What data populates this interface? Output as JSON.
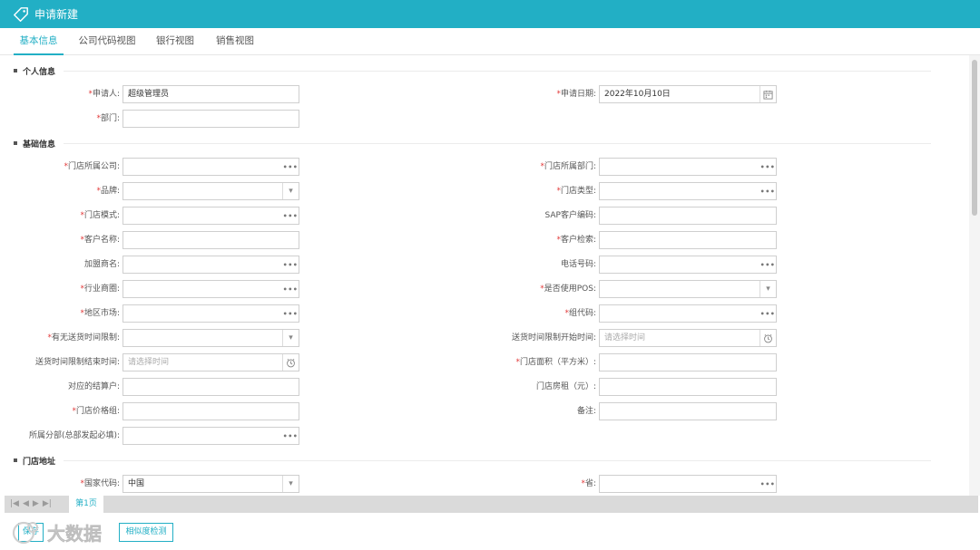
{
  "window": {
    "title": "申请新建"
  },
  "tabs": [
    {
      "label": "基本信息"
    },
    {
      "label": "公司代码视图"
    },
    {
      "label": "银行视图"
    },
    {
      "label": "销售视图"
    }
  ],
  "sections": {
    "personal": "个人信息",
    "basic": "基础信息",
    "address": "门店地址"
  },
  "fields": {
    "applicant": {
      "label": "申请人:",
      "value": "超级管理员"
    },
    "apply_date": {
      "label": "申请日期:",
      "value": "2022年10月10日"
    },
    "department": {
      "label": "部门:",
      "value": ""
    },
    "store_company": {
      "label": "门店所属公司:",
      "value": ""
    },
    "store_dept": {
      "label": "门店所属部门:",
      "value": ""
    },
    "brand": {
      "label": "品牌:",
      "value": ""
    },
    "store_type": {
      "label": "门店类型:",
      "value": ""
    },
    "store_mode": {
      "label": "门店模式:",
      "value": ""
    },
    "sap_code": {
      "label": "SAP客户编码:",
      "value": ""
    },
    "customer_name": {
      "label": "客户名称:",
      "value": ""
    },
    "customer_search": {
      "label": "客户检索:",
      "value": ""
    },
    "franchisee": {
      "label": "加盟商名:",
      "value": ""
    },
    "phone": {
      "label": "电话号码:",
      "value": ""
    },
    "business_circle": {
      "label": "行业商圈:",
      "value": ""
    },
    "use_pos": {
      "label": "是否使用POS:",
      "value": ""
    },
    "region_market": {
      "label": "地区市场:",
      "value": ""
    },
    "group_code": {
      "label": "组代码:",
      "value": ""
    },
    "delivery_limit": {
      "label": "有无送货时间限制:",
      "value": ""
    },
    "delivery_start": {
      "label": "送货时间限制开始时间:",
      "placeholder": "请选择时间"
    },
    "delivery_end": {
      "label": "送货时间限制结束时间:",
      "placeholder": "请选择时间"
    },
    "store_area": {
      "label": "门店面积（平方米）:",
      "value": ""
    },
    "settlement": {
      "label": "对应的结算户:",
      "value": ""
    },
    "store_rent": {
      "label": "门店房租（元）:",
      "value": ""
    },
    "price_group": {
      "label": "门店价格组:",
      "value": ""
    },
    "remark": {
      "label": "备注:",
      "value": ""
    },
    "branch": {
      "label": "所属分部(总部发起必填):",
      "value": ""
    },
    "country_code": {
      "label": "国家代码:",
      "value": "中国"
    },
    "province": {
      "label": "省:",
      "value": ""
    }
  },
  "pager": {
    "page_label": "第1页"
  },
  "footer": {
    "btn1": "保存",
    "btn2": "相似度检测"
  },
  "watermark": {
    "text": "大数据"
  },
  "colors": {
    "accent": "#22afc5",
    "required": "#e23b3b"
  }
}
